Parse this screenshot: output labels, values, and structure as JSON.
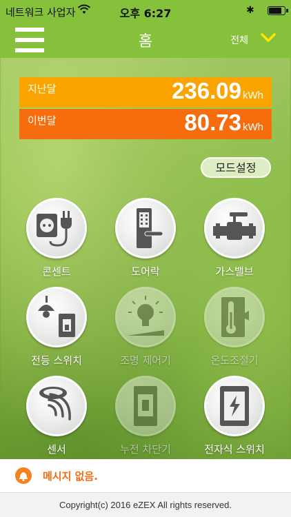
{
  "status": {
    "carrier": "네트워크 사업자",
    "time": "오후 6:27",
    "bluetooth": "✱",
    "battery_level": 0.9
  },
  "nav": {
    "title": "홈",
    "filter_label": "전체"
  },
  "energy": {
    "last": {
      "label": "지난달",
      "value": "236.09",
      "unit": "kWh"
    },
    "current": {
      "label": "이번달",
      "value": "80.73",
      "unit": "kWh"
    }
  },
  "mode_button": "모드설정",
  "devices": [
    {
      "name": "콘센트",
      "icon": "outlet-plug-icon",
      "active": true
    },
    {
      "name": "도어락",
      "icon": "door-lock-icon",
      "active": true
    },
    {
      "name": "가스밸브",
      "icon": "gas-valve-icon",
      "active": true
    },
    {
      "name": "전등 스위치",
      "icon": "light-switch-icon",
      "active": true
    },
    {
      "name": "조명 제어기",
      "icon": "light-bulb-icon",
      "active": false
    },
    {
      "name": "온도조절기",
      "icon": "thermometer-icon",
      "active": false
    },
    {
      "name": "센서",
      "icon": "sensor-icon",
      "active": true
    },
    {
      "name": "누전 차단기",
      "icon": "circuit-breaker-icon",
      "active": false
    },
    {
      "name": "전자식 스위치",
      "icon": "electronic-switch-icon",
      "active": true
    }
  ],
  "message": "메시지 없음.",
  "footer": "Copyright(c) 2016 eZEX All rights reserved.",
  "colors": {
    "accent": "#86c13b",
    "last_month": "#f9a400",
    "this_month": "#f56d0c"
  }
}
